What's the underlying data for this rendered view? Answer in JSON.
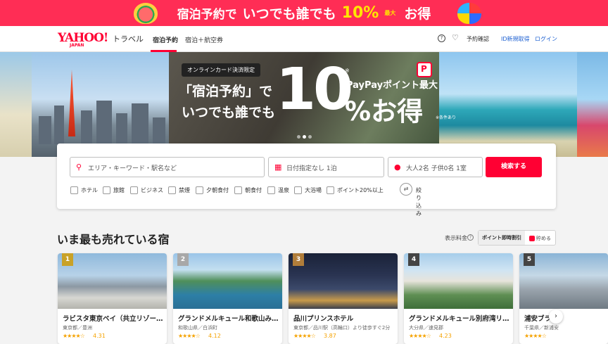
{
  "promo": {
    "part1": "宿泊予約で",
    "part2": "いつでも誰でも",
    "part3": "10%",
    "part4": "最大",
    "part5": "お得"
  },
  "header": {
    "logo": "YAHOO!",
    "logo_sub": "JAPAN",
    "logo_travel": "トラベル",
    "tabs": [
      {
        "label": "宿泊予約",
        "active": true
      },
      {
        "label": "宿泊＋航空券",
        "active": false
      }
    ],
    "booking_check": "予約確認",
    "register": "ID新規取得",
    "login": "ログイン"
  },
  "hero": {
    "badge": "オンラインカード決済限定",
    "line1": "「宿泊予約」で",
    "line2": "いつでも誰でも",
    "big": "10",
    "star": "※",
    "paypay": "PayPayポイント最大",
    "oken": "%お得",
    "note": "※条件あり",
    "pp_logo": "P"
  },
  "search": {
    "area_placeholder": "エリア・キーワード・駅名など",
    "date": "日付指定なし 1泊",
    "guests": "大人2名 子供0名 1室",
    "button": "検索する",
    "filters": [
      "ホテル",
      "旅館",
      "ビジネス",
      "禁煙",
      "夕朝食付",
      "朝食付",
      "温泉",
      "大浴場",
      "ポイント20%以上"
    ],
    "refine": "絞り込み"
  },
  "section": {
    "title": "いま最も売れている宿",
    "fee_label": "表示料金",
    "toggle_on": "ポイント即時割引",
    "toggle_off": "貯める"
  },
  "hotels": [
    {
      "rank": "1",
      "name": "ラビスタ東京ベイ（共立リゾー…",
      "location": "東京都／豊洲",
      "stars": "★★★★☆",
      "score": "4.31",
      "rank_color": "#c9a227"
    },
    {
      "rank": "2",
      "name": "グランドメルキュール和歌山み…",
      "location": "和歌山県／白浜町",
      "stars": "★★★★☆",
      "score": "4.12",
      "rank_color": "#a8a8a8"
    },
    {
      "rank": "3",
      "name": "品川プリンスホテル",
      "location": "東京都／品川駅（高輪口）より徒歩すぐ2分",
      "stars": "★★★★☆",
      "score": "3.87",
      "rank_color": "#b07d3a"
    },
    {
      "rank": "4",
      "name": "グランドメルキュール別府湾リ…",
      "location": "大分県／速見郡",
      "stars": "★★★★☆",
      "score": "4.23",
      "rank_color": "#444444"
    },
    {
      "rank": "5",
      "name": "浦安ブラ",
      "location": "千葉県／新浦安",
      "stars": "★★★★☆",
      "score": "",
      "rank_color": "#444444"
    }
  ],
  "colors": {
    "brand": "#ff0033",
    "promo_bg": "#ff2d55",
    "star": "#f5a200"
  }
}
